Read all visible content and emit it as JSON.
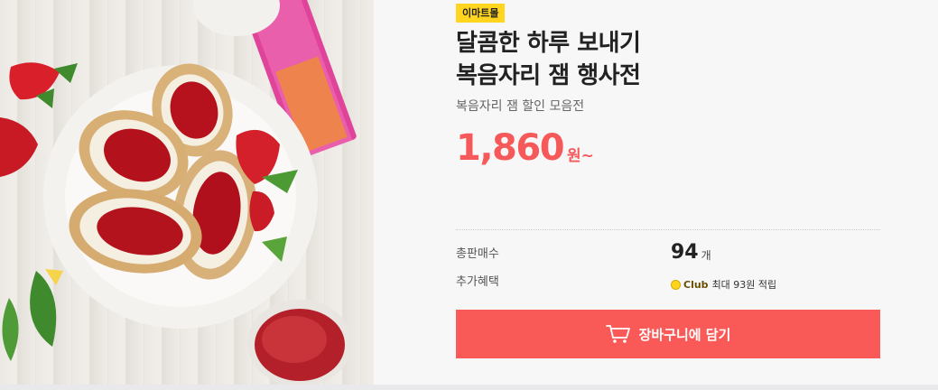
{
  "product": {
    "store_badge": "이마트몰",
    "title_line1": "달콤한 하루 보내기",
    "title_line2": "복음자리 잼 행사전",
    "subtitle": "복음자리 잼 할인 모음전",
    "price": "1,860",
    "price_unit": "원~",
    "image_icon": "strawberry-jam-toast-image"
  },
  "stats": {
    "sold_label": "총판매수",
    "sold_count": "94",
    "sold_unit": "개",
    "benefit_label": "추가혜택",
    "club_name": "Club",
    "benefit_text": "최대 93원 적립"
  },
  "actions": {
    "cart_label": "장바구니에 담기",
    "cart_icon": "shopping-cart-icon"
  },
  "colors": {
    "accent": "#fa5a57",
    "price": "#f55959",
    "badge": "#ffd51f"
  }
}
